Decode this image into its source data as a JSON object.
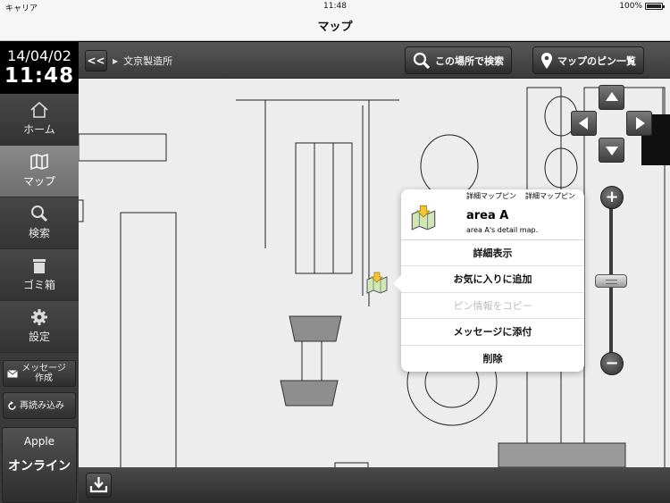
{
  "status": {
    "carrier": "キャリア",
    "time": "11:48",
    "battery": "100%"
  },
  "nav": {
    "title": "マップ"
  },
  "sidebar": {
    "date": "14/04/02",
    "time": "11:48",
    "items": [
      {
        "label": "ホーム",
        "icon": "home-icon"
      },
      {
        "label": "マップ",
        "icon": "map-icon",
        "active": true
      },
      {
        "label": "検索",
        "icon": "search-icon"
      },
      {
        "label": "ゴミ箱",
        "icon": "trash-icon"
      },
      {
        "label": "設定",
        "icon": "gear-icon"
      }
    ],
    "message_label": "メッセージ作成",
    "reload_label": "再読み込み",
    "account_name": "Apple",
    "account_status": "オンライン"
  },
  "toolbar": {
    "back_label": "<<",
    "breadcrumb": "文京製造所",
    "search_here_label": "この場所で検索",
    "pin_list_label": "マップのピン一覧"
  },
  "popover": {
    "type_label_1": "詳細マップピン",
    "type_label_2": "詳細マップピン",
    "name": "area A",
    "description": "area A's detail map.",
    "actions": [
      {
        "label": "詳細表示",
        "enabled": true
      },
      {
        "label": "お気に入りに追加",
        "enabled": true
      },
      {
        "label": "ピン情報をコピー",
        "enabled": false
      },
      {
        "label": "メッセージに添付",
        "enabled": true
      },
      {
        "label": "削除",
        "enabled": true
      }
    ]
  },
  "zoom": {
    "in_label": "+",
    "out_label": "−"
  },
  "colors": {
    "sidebar_bg": "#3a3a3a",
    "active_item": "#7a7a7a",
    "map_bg": "#ededed"
  }
}
